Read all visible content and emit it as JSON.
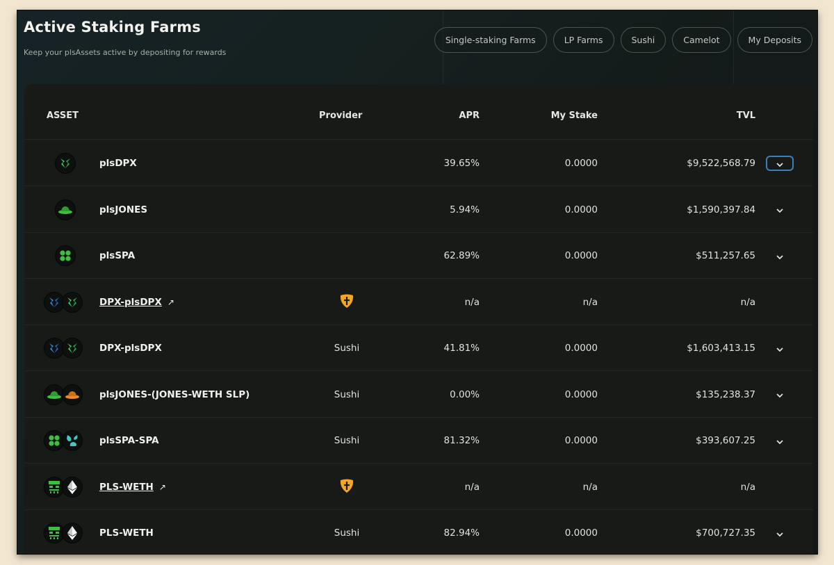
{
  "header": {
    "title": "Active Staking Farms",
    "subtitle": "Keep your plsAssets active by depositing for rewards"
  },
  "filters": [
    "Single-staking Farms",
    "LP Farms",
    "Sushi",
    "Camelot",
    "My Deposits"
  ],
  "table": {
    "columns": {
      "asset": "ASSET",
      "provider": "Provider",
      "apr": "APR",
      "stake": "My Stake",
      "tvl": "TVL"
    },
    "rows": [
      {
        "name": "plsDPX",
        "provider": "",
        "apr": "39.65%",
        "stake": "0.0000",
        "tvl": "$9,522,568.79",
        "icons": [
          "dpx-green-icon"
        ],
        "link": false,
        "expand": true,
        "active": true
      },
      {
        "name": "plsJONES",
        "provider": "",
        "apr": "5.94%",
        "stake": "0.0000",
        "tvl": "$1,590,397.84",
        "icons": [
          "jones-green-hat-icon"
        ],
        "link": false,
        "expand": true
      },
      {
        "name": "plsSPA",
        "provider": "",
        "apr": "62.89%",
        "stake": "0.0000",
        "tvl": "$511,257.65",
        "icons": [
          "spa-green-icon"
        ],
        "link": false,
        "expand": true
      },
      {
        "name": "DPX-plsDPX",
        "provider": "camelot-icon",
        "apr": "n/a",
        "stake": "n/a",
        "tvl": "n/a",
        "icons": [
          "dpx-blue-icon",
          "dpx-green-icon"
        ],
        "link": true,
        "expand": false
      },
      {
        "name": "DPX-plsDPX",
        "provider": "Sushi",
        "apr": "41.81%",
        "stake": "0.0000",
        "tvl": "$1,603,413.15",
        "icons": [
          "dpx-blue-icon",
          "dpx-green-icon"
        ],
        "link": false,
        "expand": true
      },
      {
        "name": "plsJONES-(JONES-WETH SLP)",
        "provider": "Sushi",
        "apr": "0.00%",
        "stake": "0.0000",
        "tvl": "$135,238.37",
        "icons": [
          "jones-green-hat-icon",
          "jones-orange-hat-icon"
        ],
        "link": false,
        "expand": true
      },
      {
        "name": "plsSPA-SPA",
        "provider": "Sushi",
        "apr": "81.32%",
        "stake": "0.0000",
        "tvl": "$393,607.25",
        "icons": [
          "spa-green-icon",
          "spa-teal-icon"
        ],
        "link": false,
        "expand": true
      },
      {
        "name": "PLS-WETH",
        "provider": "camelot-icon",
        "apr": "n/a",
        "stake": "n/a",
        "tvl": "n/a",
        "icons": [
          "pls-face-icon",
          "eth-icon"
        ],
        "link": true,
        "expand": false
      },
      {
        "name": "PLS-WETH",
        "provider": "Sushi",
        "apr": "82.94%",
        "stake": "0.0000",
        "tvl": "$700,727.35",
        "icons": [
          "pls-face-icon",
          "eth-icon"
        ],
        "link": false,
        "expand": true
      }
    ]
  },
  "icons": {
    "external_link": "↗",
    "chevron": "chevron-down-icon"
  },
  "colors": {
    "accent_blue": "#3e7fb5",
    "camelot_orange": "#f5a623",
    "pls_green": "#3fbf3f"
  }
}
